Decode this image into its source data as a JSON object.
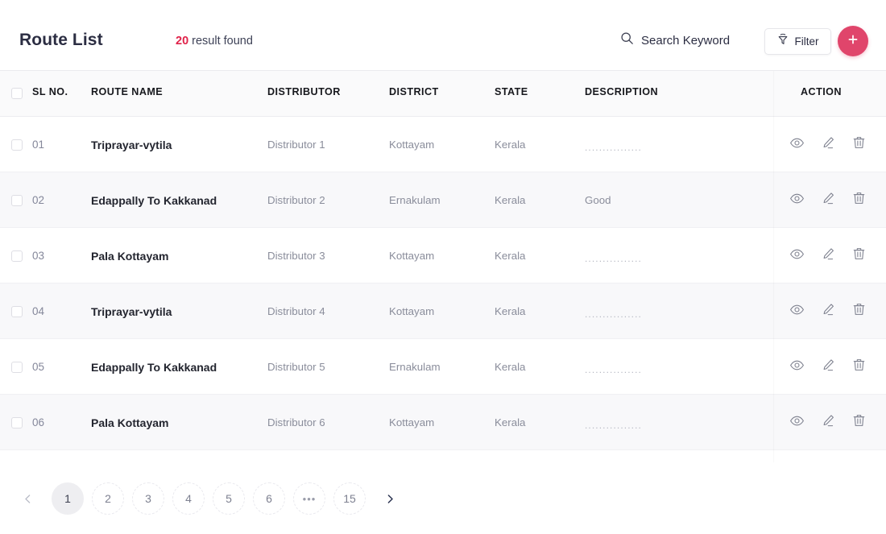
{
  "header": {
    "title": "Route List",
    "result_count": "20",
    "result_label": " result found",
    "search_placeholder": "Search Keyword",
    "filter_label": "Filter",
    "add_label": "+",
    "accent_color": "#e0456b",
    "count_color": "#e0234a"
  },
  "table": {
    "columns": [
      {
        "key": "slno",
        "label": "SL NO."
      },
      {
        "key": "route_name",
        "label": "ROUTE NAME"
      },
      {
        "key": "distributor",
        "label": "DISTRIBUTOR"
      },
      {
        "key": "district",
        "label": "DISTRICT"
      },
      {
        "key": "state",
        "label": "STATE"
      },
      {
        "key": "description",
        "label": "DESCRIPTION"
      },
      {
        "key": "action",
        "label": "ACTION"
      }
    ],
    "dots_placeholder": "................",
    "rows": [
      {
        "slno": "01",
        "route_name": "Triprayar-vytila",
        "distributor": "Distributor 1",
        "district": "Kottayam",
        "state": "Kerala",
        "description": "................"
      },
      {
        "slno": "02",
        "route_name": "Edappally To Kakkanad",
        "distributor": "Distributor 2",
        "district": "Ernakulam",
        "state": "Kerala",
        "description": "Good"
      },
      {
        "slno": "03",
        "route_name": "Pala Kottayam",
        "distributor": "Distributor 3",
        "district": "Kottayam",
        "state": "Kerala",
        "description": "................"
      },
      {
        "slno": "04",
        "route_name": "Triprayar-vytila",
        "distributor": "Distributor 4",
        "district": "Kottayam",
        "state": "Kerala",
        "description": "................"
      },
      {
        "slno": "05",
        "route_name": "Edappally To Kakkanad",
        "distributor": "Distributor 5",
        "district": "Ernakulam",
        "state": "Kerala",
        "description": "................"
      },
      {
        "slno": "06",
        "route_name": "Pala Kottayam",
        "distributor": "Distributor 6",
        "district": "Kottayam",
        "state": "Kerala",
        "description": "................"
      }
    ],
    "row_actions": [
      {
        "name": "view-icon",
        "label": "View"
      },
      {
        "name": "edit-icon",
        "label": "Edit"
      },
      {
        "name": "delete-icon",
        "label": "Delete"
      }
    ]
  },
  "pagination": {
    "prev_label": "‹",
    "next_label": "›",
    "current_page": "1",
    "pages": [
      "1",
      "2",
      "3",
      "4",
      "5",
      "6"
    ],
    "ellipsis": "•••",
    "last_page": "15"
  }
}
